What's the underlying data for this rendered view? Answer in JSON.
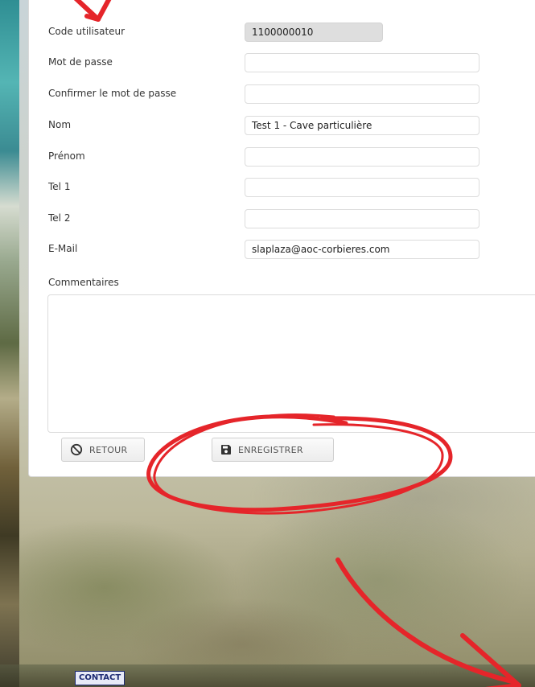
{
  "form": {
    "fields": [
      {
        "label": "Code utilisateur",
        "value": "1100000010",
        "readonly": true
      },
      {
        "label": "Mot de passe",
        "value": ""
      },
      {
        "label": "Confirmer le mot de passe",
        "value": ""
      },
      {
        "label": "Nom",
        "value": "Test 1 - Cave particulière"
      },
      {
        "label": "Prénom",
        "value": ""
      },
      {
        "label": "Tel 1",
        "value": ""
      },
      {
        "label": "Tel 2",
        "value": ""
      },
      {
        "label": "E-Mail",
        "value": "slaplaza@aoc-corbieres.com"
      }
    ],
    "comments_label": "Commentaires",
    "comments_value": ""
  },
  "buttons": {
    "retour": {
      "label": "RETOUR",
      "icon": "ban-icon"
    },
    "save": {
      "label": "ENREGISTRER",
      "icon": "floppy-disk-icon"
    }
  },
  "footer": {
    "contact_label": "CONTACT"
  },
  "colors": {
    "annotation": "#e5252a",
    "contact": "#1d2a73"
  }
}
